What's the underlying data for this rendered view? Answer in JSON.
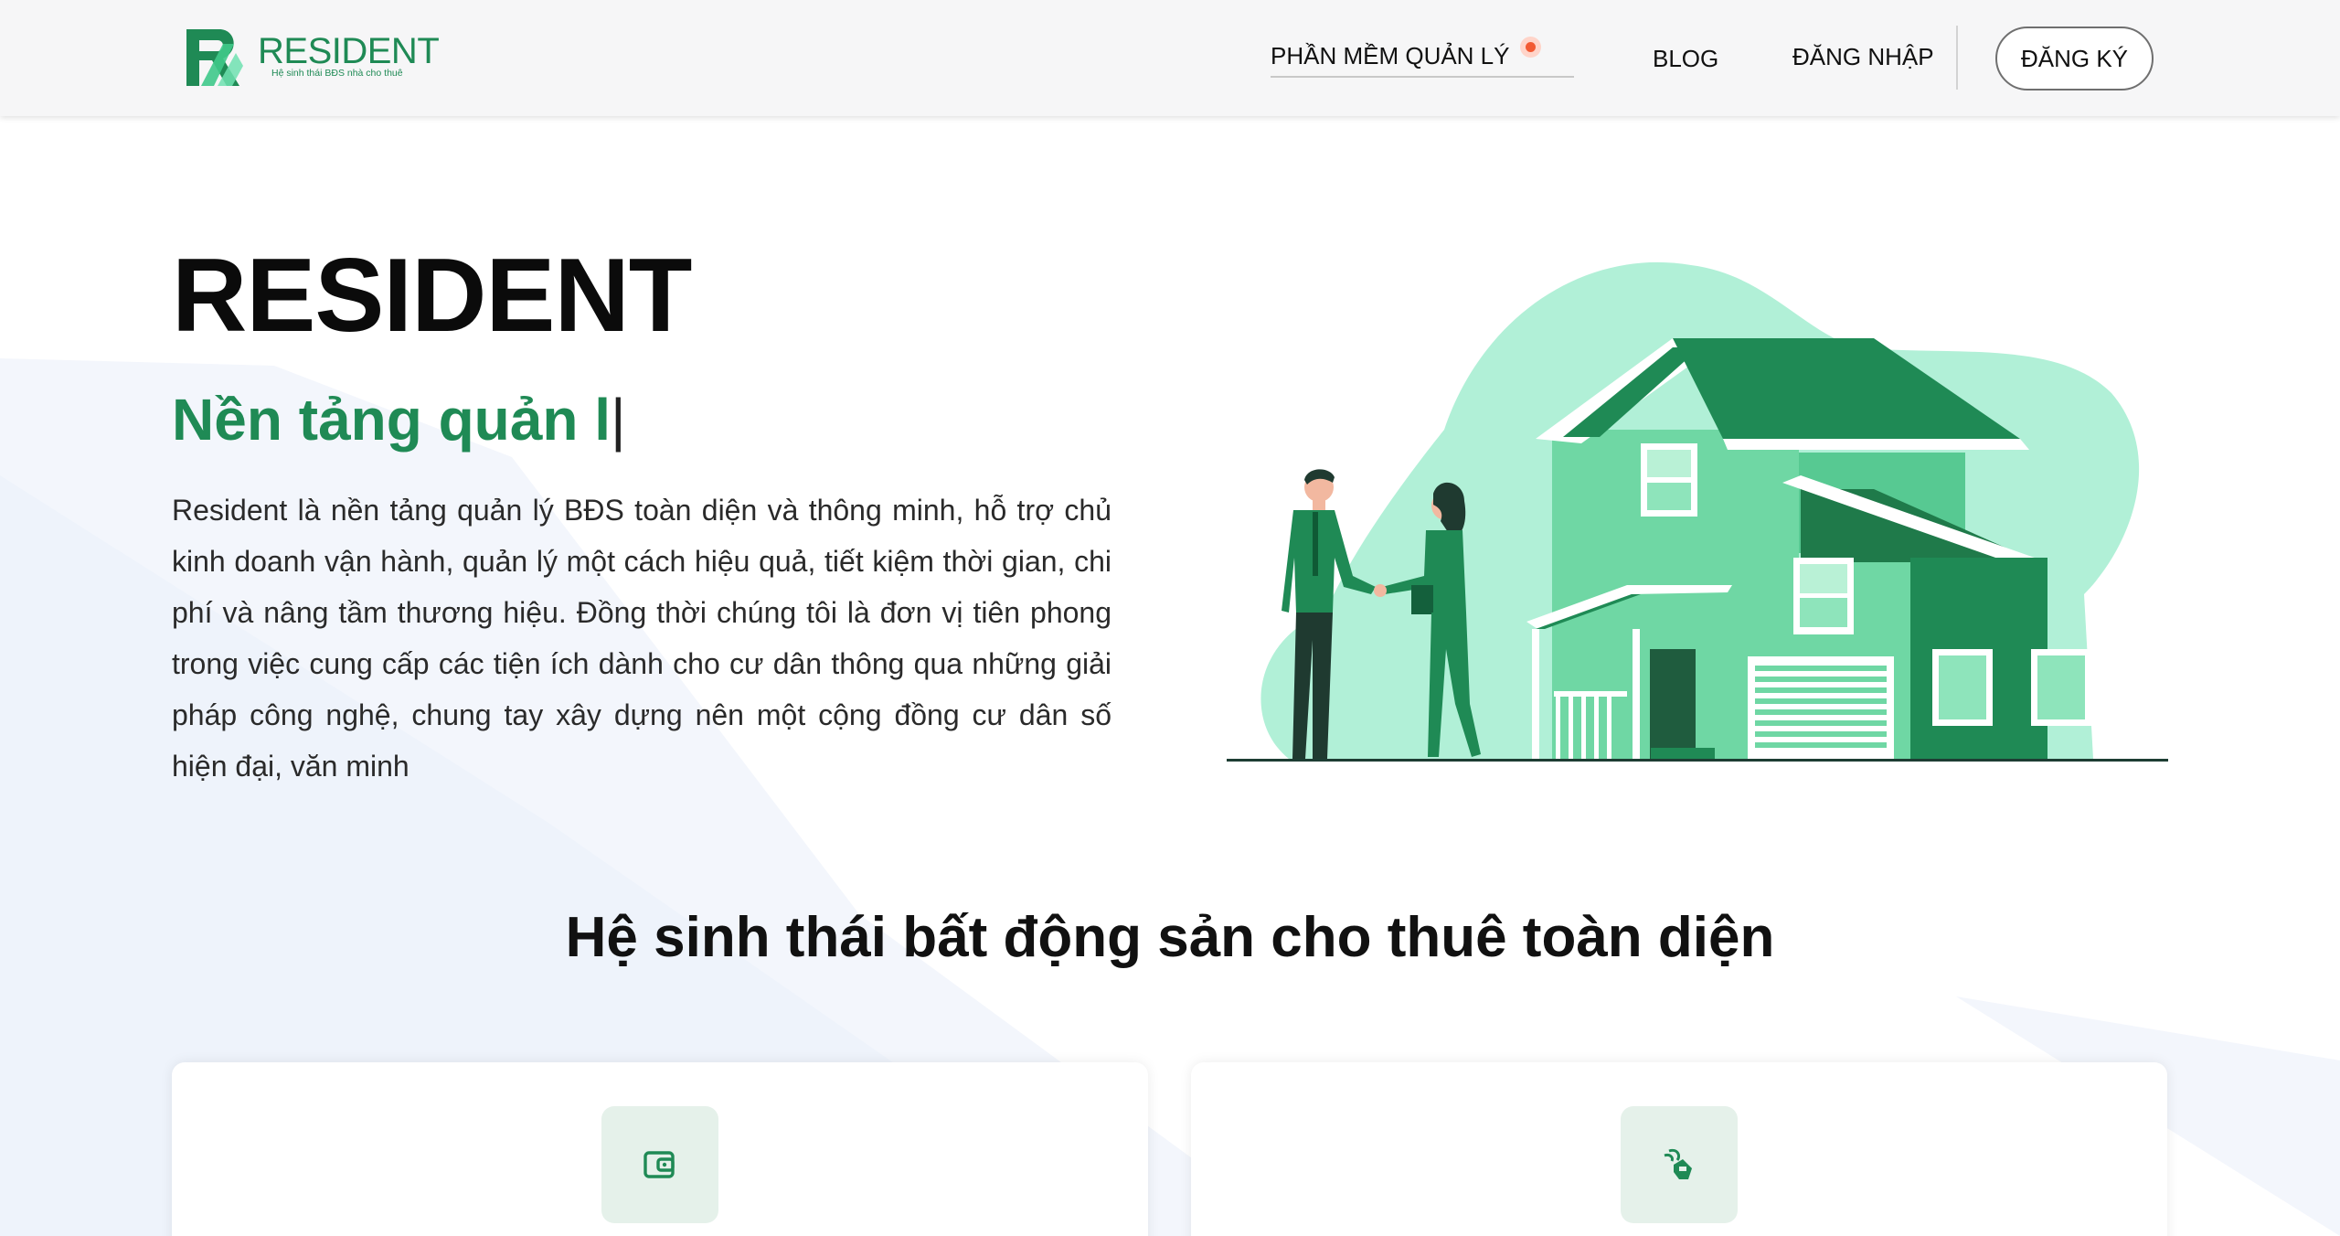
{
  "brand": {
    "name": "RESIDENT",
    "tagline": "Hệ sinh thái BĐS nhà cho thuê",
    "primary_color": "#1f8a55",
    "accent_color": "#f25a33"
  },
  "nav": {
    "software_label": "PHẦN MỀM QUẢN LÝ",
    "blog_label": "BLOG",
    "login_label": "ĐĂNG NHẬP",
    "signup_label": "ĐĂNG KÝ"
  },
  "hero": {
    "title": "RESIDENT",
    "typed_text": "Nền tảng quản l",
    "cursor": "|",
    "description": "Resident là nền tảng quản lý BĐS toàn diện và thông minh, hỗ trợ chủ kinh doanh vận hành, quản lý một cách hiệu quả, tiết kiệm thời gian, chi phí và nâng tầm thương hiệu. Đồng thời chúng tôi là đơn vị tiên phong trong việc cung cấp các tiện ích dành cho cư dân thông qua những giải pháp công nghệ, chung tay xây dựng nên một cộng đồng cư dân số hiện đại, văn minh"
  },
  "ecosystem": {
    "title": "Hệ sinh thái bất động sản cho thuê toàn diện",
    "cards": [
      {
        "icon": "wallet-icon"
      },
      {
        "icon": "contactless-payment-icon"
      }
    ]
  }
}
